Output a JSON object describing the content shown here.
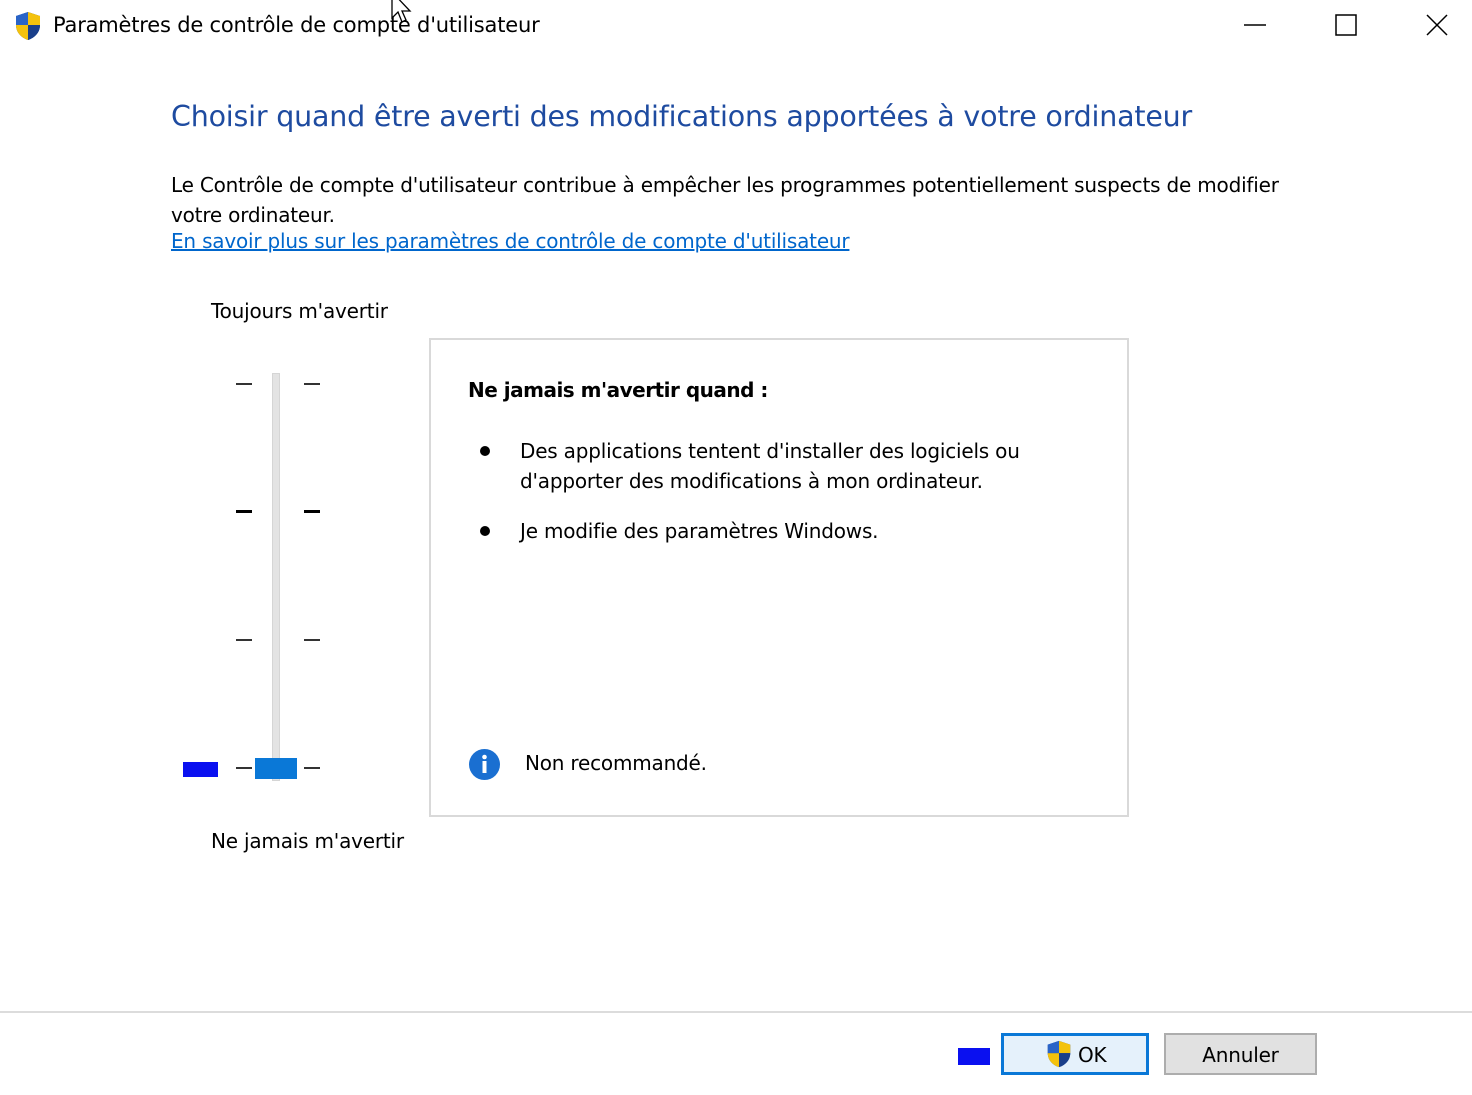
{
  "window": {
    "title": "Paramètres de contrôle de compte d'utilisateur",
    "app_icon": "uac-shield-icon",
    "controls": [
      "minimize-icon",
      "maximize-icon",
      "close-icon"
    ]
  },
  "main": {
    "heading": "Choisir quand être averti des modifications apportées à votre ordinateur",
    "description": "Le Contrôle de compte d'utilisateur contribue à empêcher les programmes potentiellement suspects de modifier votre ordinateur.",
    "learn_more_link": "En savoir plus sur les paramètres de contrôle de compte d'utilisateur"
  },
  "slider": {
    "top_label": "Toujours m'avertir",
    "bottom_label": "Ne jamais m'avertir",
    "levels": 4,
    "selected_level": 1,
    "selected_fraction": 0,
    "accent_color": "#0a78d7"
  },
  "info": {
    "title": "Ne jamais m'avertir quand :",
    "bullets": [
      "Des applications tentent d'installer des logiciels ou d'apporter des modifications à mon ordinateur.",
      "Je modifie des paramètres Windows."
    ],
    "note_icon": "info-icon",
    "note": "Non recommandé."
  },
  "footer": {
    "ok_label": "OK",
    "ok_icon": "uac-shield-icon",
    "cancel_label": "Annuler"
  },
  "colors": {
    "heading": "#1e4ba0",
    "link": "#0066cc",
    "focus_mark": "#0a10f0"
  }
}
